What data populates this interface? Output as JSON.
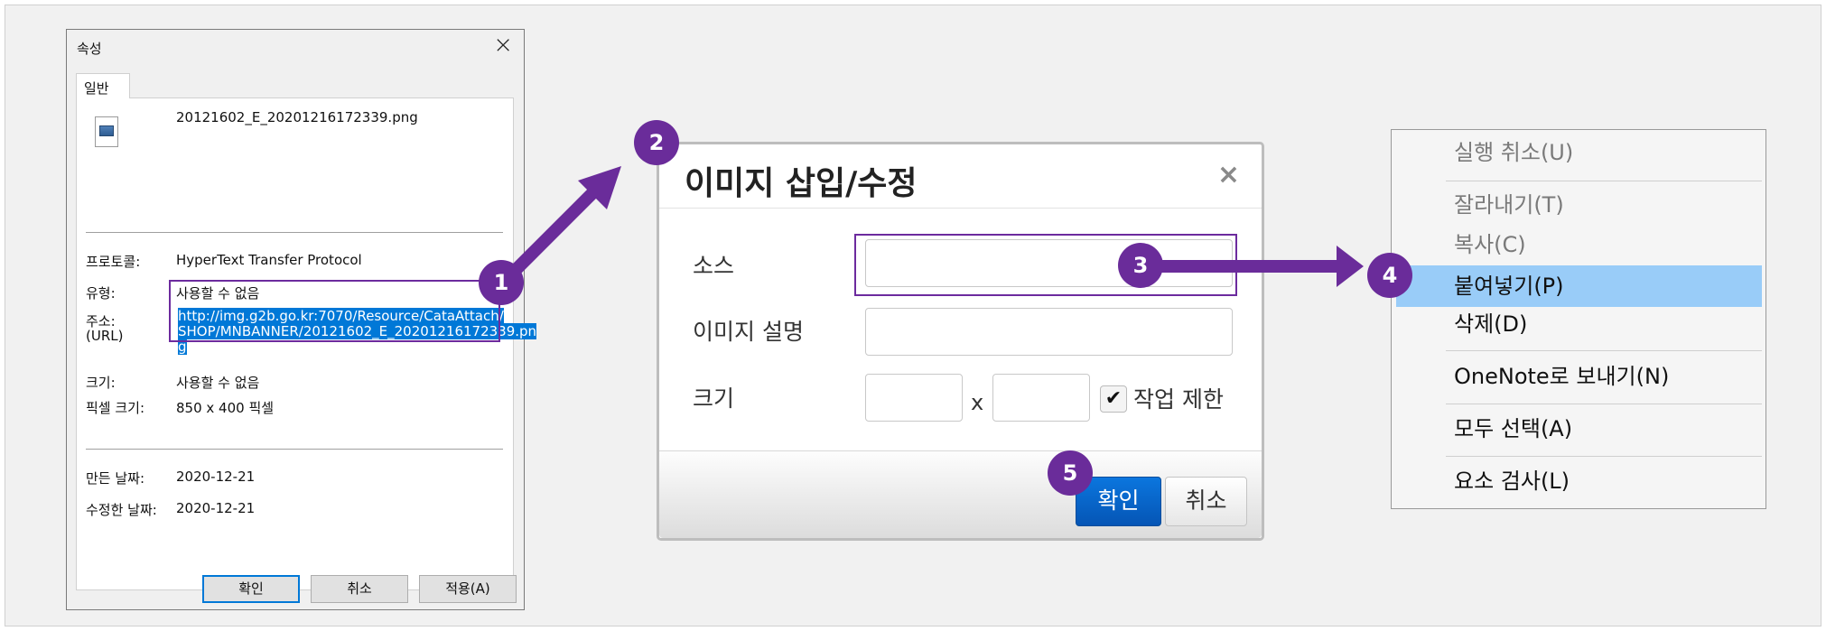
{
  "properties_dialog": {
    "title": "속성",
    "tab": "일반",
    "file_name": "20121602_E_20201216172339.png",
    "rows": [
      {
        "label": "프로토콜:",
        "value": "HyperText Transfer Protocol"
      },
      {
        "label": "유형:",
        "value": "사용할 수 없음"
      },
      {
        "label": "주소:",
        "label2": "(URL)",
        "value": "http://img.g2b.go.kr:7070/Resource/CataAttach/SHOP/MNBANNER/20121602_E_20201216172339.png"
      },
      {
        "label": "크기:",
        "value": "사용할 수 없음"
      },
      {
        "label": "픽셀 크기:",
        "value": "850 x 400 픽셀"
      },
      {
        "label": "만든 날짜:",
        "value": "2020-12-21"
      },
      {
        "label": "수정한 날짜:",
        "value": "2020-12-21"
      }
    ],
    "url_lines": [
      "http://img.g2b.go.kr:7070/Resource/CataAttach/",
      "SHOP/MNBANNER/20121602_E_20201216172339.pn",
      "g"
    ],
    "buttons": {
      "ok": "확인",
      "cancel": "취소",
      "apply": "적용(A)"
    }
  },
  "image_dialog": {
    "title": "이미지 삽입/수정",
    "close": "×",
    "fields": {
      "source": "소스",
      "description": "이미지 설명",
      "size": "크기"
    },
    "size_separator": "x",
    "constrain_label": "작업 제한",
    "constrain_checked": true,
    "buttons": {
      "ok": "확인",
      "cancel": "취소"
    }
  },
  "context_menu": {
    "items": [
      {
        "label": "실행 취소(U)",
        "enabled": false
      },
      {
        "label": "잘라내기(T)",
        "enabled": false
      },
      {
        "label": "복사(C)",
        "enabled": false
      },
      {
        "label": "붙여넣기(P)",
        "enabled": true,
        "highlighted": true
      },
      {
        "label": "삭제(D)",
        "enabled": true
      },
      {
        "label": "OneNote로 보내기(N)",
        "enabled": true
      },
      {
        "label": "모두 선택(A)",
        "enabled": true
      },
      {
        "label": "요소 검사(L)",
        "enabled": true
      }
    ]
  },
  "steps": [
    "1",
    "2",
    "3",
    "4",
    "5"
  ],
  "colors": {
    "annotation": "#6a2c9a",
    "selection": "#0078d7",
    "menu_highlight": "#99ccf8",
    "primary_button": "#0b6fd6"
  }
}
